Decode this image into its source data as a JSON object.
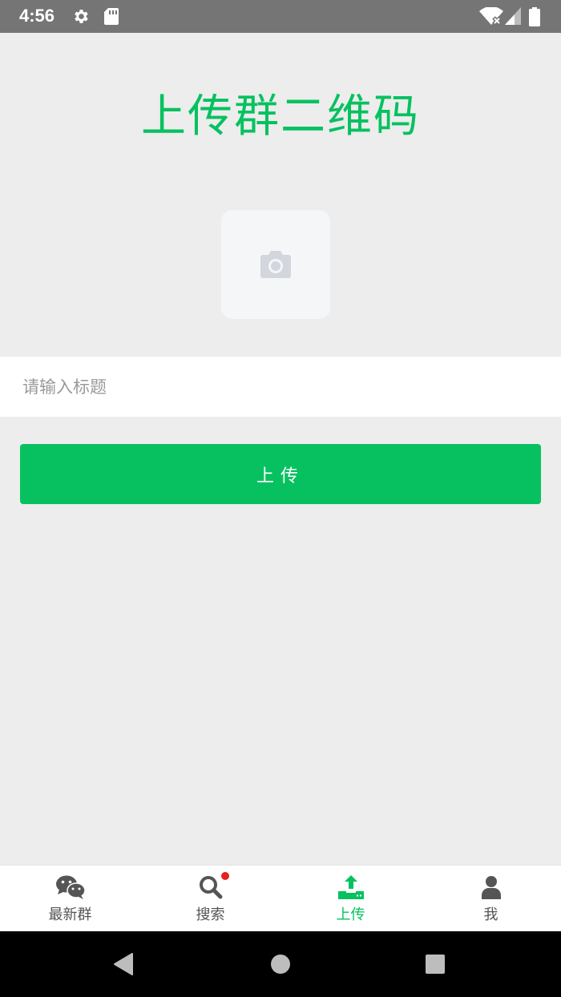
{
  "status_bar": {
    "time": "4:56",
    "icons": [
      "gear-icon",
      "sd-card-icon",
      "wifi-icon",
      "cell-signal-icon",
      "battery-icon"
    ]
  },
  "page": {
    "title": "上传群二维码"
  },
  "upload": {
    "icon": "camera-icon"
  },
  "form": {
    "title_placeholder": "请输入标题",
    "title_value": "",
    "submit_label": "上传"
  },
  "tabs": [
    {
      "label": "最新群",
      "icon": "wechat-icon",
      "active": false
    },
    {
      "label": "搜索",
      "icon": "search-icon",
      "active": false,
      "badge": true
    },
    {
      "label": "上传",
      "icon": "upload-icon",
      "active": true
    },
    {
      "label": "我",
      "icon": "user-icon",
      "active": false
    }
  ],
  "nav": {
    "buttons": [
      "back-icon",
      "home-icon",
      "recents-icon"
    ]
  },
  "colors": {
    "accent": "#07c160",
    "status_bar": "#757575",
    "background": "#ededed",
    "tab_inactive": "#555555",
    "camera_icon": "#d3d6dc",
    "badge": "#e6201e"
  }
}
